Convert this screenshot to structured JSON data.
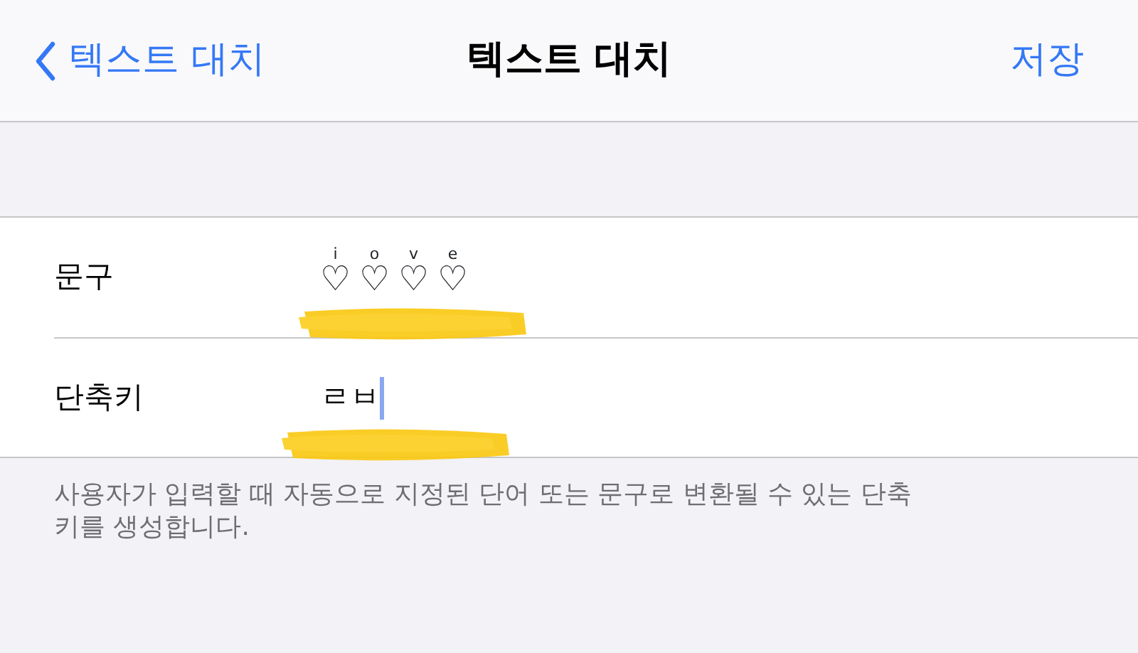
{
  "nav": {
    "back_label": "텍스트 대치",
    "title": "텍스트 대치",
    "action": "저장"
  },
  "rows": [
    {
      "kind": "ruby",
      "label": "문구",
      "glyphs": [
        {
          "top": "i",
          "mark": "♡"
        },
        {
          "top": "o",
          "mark": "♡"
        },
        {
          "top": "v",
          "mark": "♡"
        },
        {
          "top": "e",
          "mark": "♡"
        }
      ],
      "highlighted": true,
      "focused": false
    },
    {
      "kind": "text",
      "label": "단축키",
      "value": "ㄹㅂ",
      "highlighted": true,
      "focused": true
    }
  ],
  "footer": "사용자가 입력할 때 자동으로 지정된 단어 또는 문구로 변환될 수 있는 단축키를 생성합니다."
}
